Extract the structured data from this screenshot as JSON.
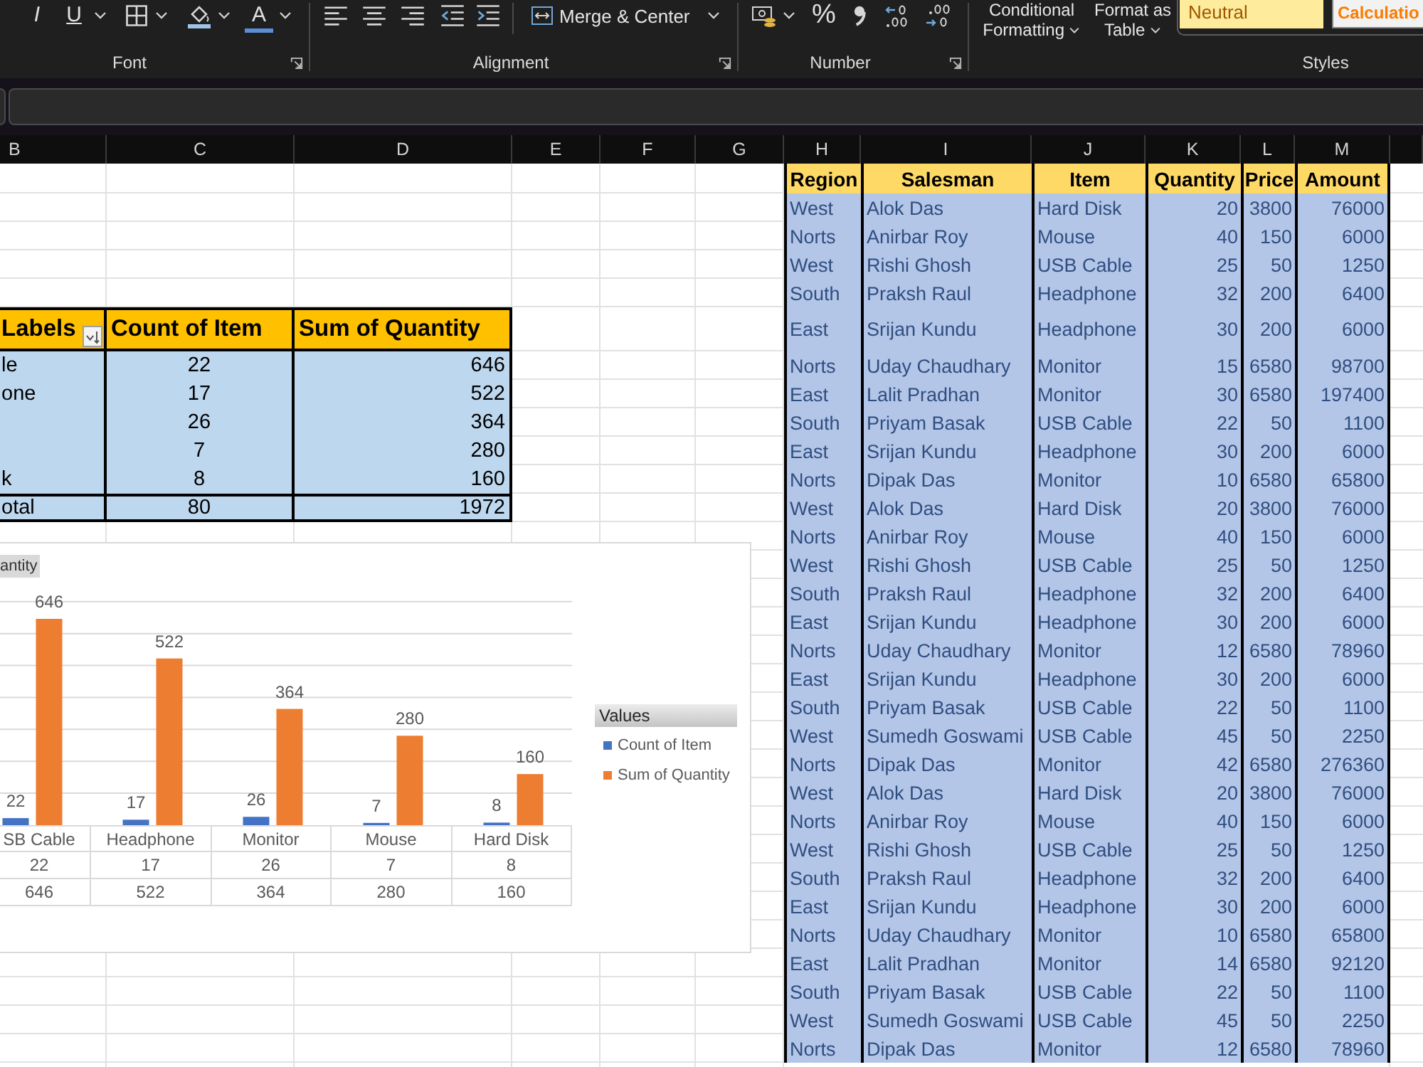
{
  "ribbon": {
    "groups": [
      {
        "kind": "font",
        "label": "Font",
        "italic": "I",
        "underline": "U",
        "font_color": "A"
      },
      {
        "kind": "alignment",
        "label": "Alignment",
        "merge_button": "Merge & Center"
      },
      {
        "kind": "number",
        "label": "Number",
        "percent": "%"
      },
      {
        "kind": "styles",
        "label": "Styles",
        "buttons": [
          "Conditional Formatting",
          "Format as Table"
        ],
        "cell_styles": [
          {
            "kind": "neutral",
            "label": "Neutral"
          },
          {
            "kind": "calculation",
            "label": "Calculatio"
          }
        ]
      }
    ]
  },
  "column_headers": [
    "B",
    "C",
    "D",
    "E",
    "F",
    "G",
    "H",
    "I",
    "J",
    "K",
    "L",
    "M"
  ],
  "pivot": {
    "headers": [
      "Labels",
      "Count of Item",
      "Sum of Quantity"
    ],
    "rows": [
      {
        "label": "le",
        "count": "22",
        "sum": "646"
      },
      {
        "label": "one",
        "count": "17",
        "sum": "522"
      },
      {
        "count": "26",
        "sum": "364"
      },
      {
        "count": "7",
        "sum": "280"
      },
      {
        "label": "k",
        "count": "8",
        "sum": "160"
      }
    ],
    "total": {
      "label": "otal",
      "count": "80",
      "sum": "1972"
    }
  },
  "chart": {
    "field_button": "antity",
    "legend_title": "Values",
    "chart_data": {
      "type": "bar",
      "categories": [
        "SB Cable",
        "Headphone",
        "Monitor",
        "Mouse",
        "Hard Disk"
      ],
      "series": [
        {
          "name": "Count of Item",
          "color": "#4472c4",
          "values": [
            22,
            17,
            26,
            7,
            8
          ]
        },
        {
          "name": "Sum of Quantity",
          "color": "#ed7d31",
          "values": [
            646,
            522,
            364,
            280,
            160
          ]
        }
      ],
      "data_labels": true,
      "value_labels": [
        [
          "22",
          "17",
          "26",
          "7",
          "8"
        ],
        [
          "646",
          "522",
          "364",
          "280",
          "160"
        ]
      ],
      "legend": "right",
      "grid": true
    },
    "data_table": [
      [
        "22",
        "17",
        "26",
        "7",
        "8"
      ],
      [
        "646",
        "522",
        "364",
        "280",
        "160"
      ]
    ]
  },
  "data_table": {
    "columns": [
      "Region",
      "Salesman",
      "Item",
      "Quantity",
      "Price",
      "Amount"
    ],
    "rows": [
      [
        "West",
        "Alok Das",
        "Hard Disk",
        "20",
        "3800",
        "76000"
      ],
      [
        "Norts",
        "Anirbar Roy",
        "Mouse",
        "40",
        "150",
        "6000"
      ],
      [
        "West",
        "Rishi Ghosh",
        "USB Cable",
        "25",
        "50",
        "1250"
      ],
      [
        "South",
        "Praksh Raul",
        "Headphone",
        "32",
        "200",
        "6400"
      ],
      [
        "East",
        "Srijan Kundu",
        "Headphone",
        "30",
        "200",
        "6000"
      ],
      [
        "Norts",
        "Uday Chaudhary",
        "Monitor",
        "15",
        "6580",
        "98700"
      ],
      [
        "East",
        "Lalit Pradhan",
        "Monitor",
        "30",
        "6580",
        "197400"
      ],
      [
        "South",
        "Priyam Basak",
        "USB Cable",
        "22",
        "50",
        "1100"
      ],
      [
        "East",
        "Srijan Kundu",
        "Headphone",
        "30",
        "200",
        "6000"
      ],
      [
        "Norts",
        "Dipak Das",
        "Monitor",
        "10",
        "6580",
        "65800"
      ],
      [
        "West",
        "Alok Das",
        "Hard Disk",
        "20",
        "3800",
        "76000"
      ],
      [
        "Norts",
        "Anirbar Roy",
        "Mouse",
        "40",
        "150",
        "6000"
      ],
      [
        "West",
        "Rishi Ghosh",
        "USB Cable",
        "25",
        "50",
        "1250"
      ],
      [
        "South",
        "Praksh Raul",
        "Headphone",
        "32",
        "200",
        "6400"
      ],
      [
        "East",
        "Srijan Kundu",
        "Headphone",
        "30",
        "200",
        "6000"
      ],
      [
        "Norts",
        "Uday Chaudhary",
        "Monitor",
        "12",
        "6580",
        "78960"
      ],
      [
        "East",
        "Srijan Kundu",
        "Headphone",
        "30",
        "200",
        "6000"
      ],
      [
        "South",
        "Priyam Basak",
        "USB Cable",
        "22",
        "50",
        "1100"
      ],
      [
        "West",
        "Sumedh Goswami",
        "USB Cable",
        "45",
        "50",
        "2250"
      ],
      [
        "Norts",
        "Dipak Das",
        "Monitor",
        "42",
        "6580",
        "276360"
      ],
      [
        "West",
        "Alok Das",
        "Hard Disk",
        "20",
        "3800",
        "76000"
      ],
      [
        "Norts",
        "Anirbar Roy",
        "Mouse",
        "40",
        "150",
        "6000"
      ],
      [
        "West",
        "Rishi Ghosh",
        "USB Cable",
        "25",
        "50",
        "1250"
      ],
      [
        "South",
        "Praksh Raul",
        "Headphone",
        "32",
        "200",
        "6400"
      ],
      [
        "East",
        "Srijan Kundu",
        "Headphone",
        "30",
        "200",
        "6000"
      ],
      [
        "Norts",
        "Uday Chaudhary",
        "Monitor",
        "10",
        "6580",
        "65800"
      ],
      [
        "East",
        "Lalit Pradhan",
        "Monitor",
        "14",
        "6580",
        "92120"
      ],
      [
        "South",
        "Priyam Basak",
        "USB Cable",
        "22",
        "50",
        "1100"
      ],
      [
        "West",
        "Sumedh Goswami",
        "USB Cable",
        "45",
        "50",
        "2250"
      ],
      [
        "Norts",
        "Dipak Das",
        "Monitor",
        "12",
        "6580",
        "78960"
      ]
    ]
  }
}
